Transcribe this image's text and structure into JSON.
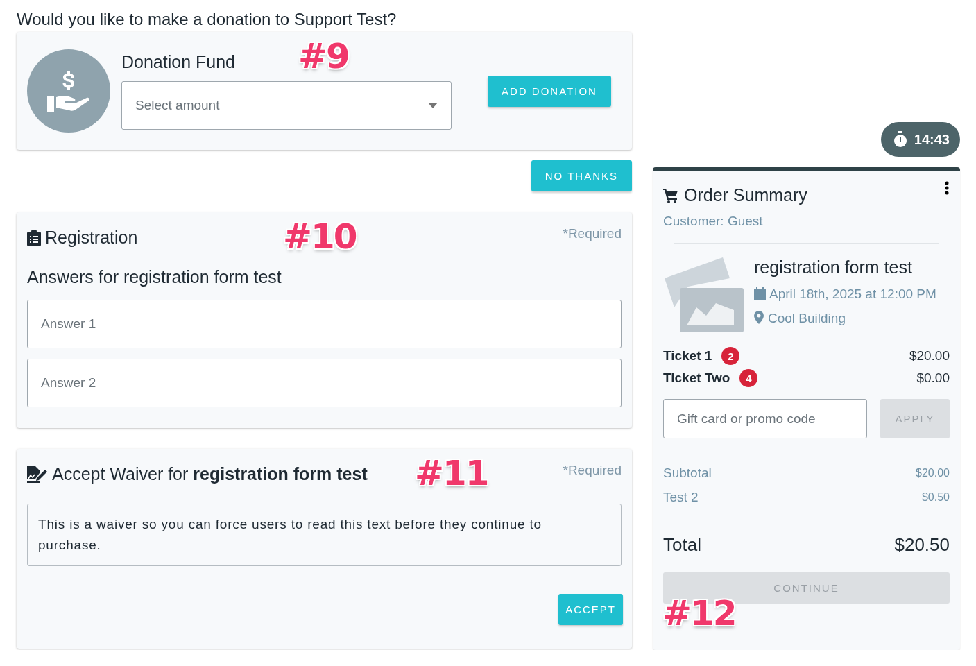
{
  "page_title": "Would you like to make a donation to Support Test?",
  "donation": {
    "fund_label": "Donation Fund",
    "amount_select": {
      "placeholder": "Select amount"
    },
    "add_button": "ADD DONATION",
    "annotation": "#9"
  },
  "no_thanks_button": "NO THANKS",
  "registration": {
    "title": "Registration",
    "required": "*Required",
    "annotation": "#10",
    "subtitle": "Answers for registration form test",
    "fields": [
      {
        "placeholder": "Answer 1"
      },
      {
        "placeholder": "Answer 2"
      }
    ]
  },
  "waiver": {
    "title": "Accept Waiver for **registration form test**",
    "required": "*Required",
    "annotation": "#11",
    "text": "This is a waiver so you can force users to read this text before they continue to purchase.",
    "accept_button": "ACCEPT"
  },
  "timer": "14:43",
  "order_summary": {
    "title": "Order Summary",
    "customer": "Customer: Guest",
    "event": {
      "name": "registration form test",
      "date": "April 18th, 2025 at 12:00 PM",
      "location": "Cool Building"
    },
    "tickets": [
      {
        "name": "Ticket 1",
        "quantity": "2",
        "price": "$20.00"
      },
      {
        "name": "Ticket Two",
        "quantity": "4",
        "price": "$0.00"
      }
    ],
    "promo": {
      "placeholder": "Gift card or promo code",
      "apply_button": {
        "label": "APPLY",
        "disabled": true
      }
    },
    "lines": [
      {
        "label": "Subtotal",
        "amount": "$20.00"
      },
      {
        "label": "Test 2",
        "amount": "$0.50"
      }
    ],
    "total": {
      "label": "Total",
      "amount": "$20.50"
    },
    "continue_button": {
      "label": "CONTINUE",
      "disabled": true
    },
    "annotation": "#12"
  }
}
